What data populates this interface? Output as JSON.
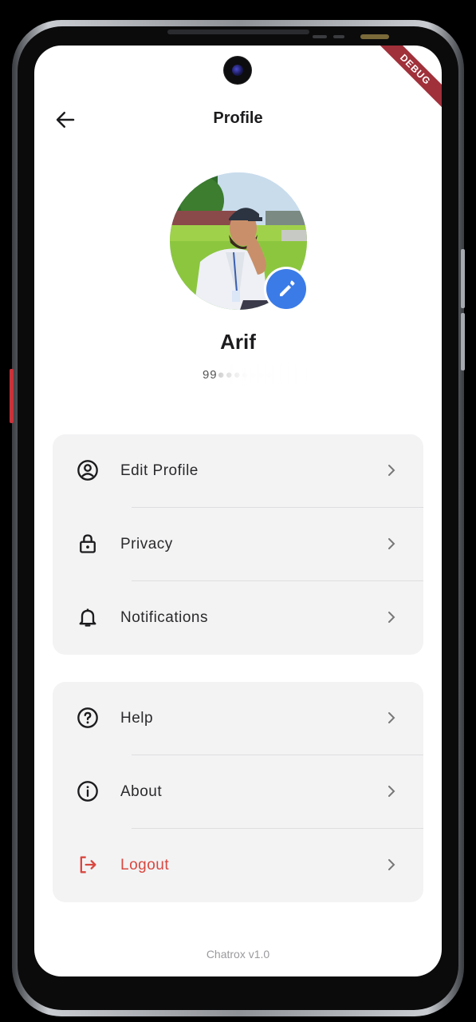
{
  "app_bar": {
    "title": "Profile"
  },
  "debug_banner": "DEBUG",
  "profile": {
    "name": "Arif",
    "phone_partial": "99"
  },
  "menu_group_1": [
    {
      "label": "Edit Profile",
      "icon": "account-circle-icon"
    },
    {
      "label": "Privacy",
      "icon": "lock-icon"
    },
    {
      "label": "Notifications",
      "icon": "bell-icon"
    }
  ],
  "menu_group_2": [
    {
      "label": "Help",
      "icon": "help-circle-icon"
    },
    {
      "label": "About",
      "icon": "info-circle-icon"
    },
    {
      "label": "Logout",
      "icon": "logout-icon"
    }
  ],
  "footer": {
    "version": "Chatrox v1.0"
  },
  "colors": {
    "accent": "#3b7be8",
    "danger": "#d9473f",
    "card_bg": "#f3f3f4"
  }
}
